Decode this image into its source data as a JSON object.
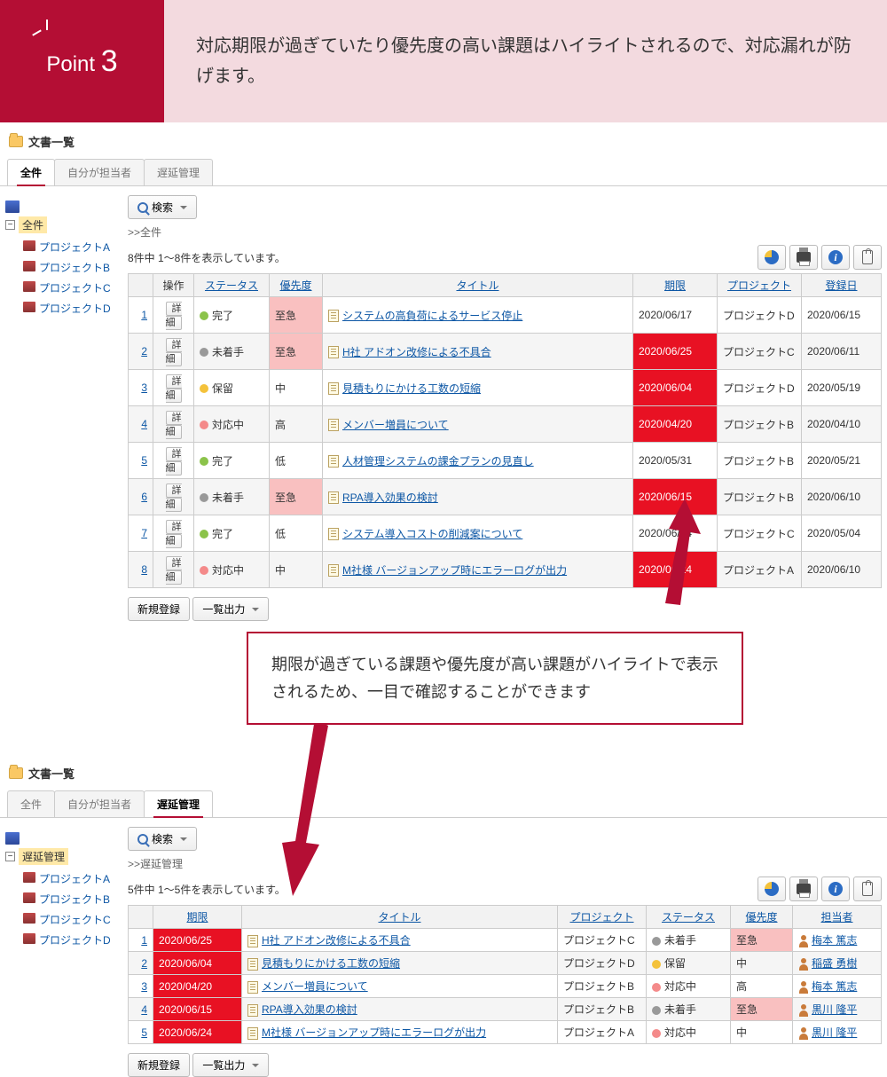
{
  "banner": {
    "point_label": "Point",
    "point_num": "3",
    "text": "対応期限が過ぎていたり優先度の高い課題はハイライトされるので、対応漏れが防げます。"
  },
  "section_title": "文書一覧",
  "tabs": {
    "all": "全件",
    "mine": "自分が担当者",
    "delay": "遅延管理"
  },
  "tree": {
    "toggle": "−",
    "root_all": "全件",
    "root_delay": "遅延管理",
    "items": [
      "プロジェクトA",
      "プロジェクトB",
      "プロジェクトC",
      "プロジェクトD"
    ]
  },
  "toolbar": {
    "search": "検索",
    "new": "新規登録",
    "export": "一覧出力"
  },
  "top": {
    "breadcrumb": ">>全件",
    "count": "8件中 1〜8件を表示しています。",
    "headers": {
      "op": "操作",
      "status": "ステータス",
      "priority": "優先度",
      "title": "タイトル",
      "due": "期限",
      "project": "プロジェクト",
      "reg": "登録日"
    },
    "detail_btn": "詳細",
    "rows": [
      {
        "n": "1",
        "status": "完了",
        "dot": "green",
        "pri": "至急",
        "pri_hl": true,
        "title": "システムの高負荷によるサービス停止",
        "due": "2020/06/17",
        "due_hl": false,
        "proj": "プロジェクトD",
        "reg": "2020/06/15",
        "stripe": false
      },
      {
        "n": "2",
        "status": "未着手",
        "dot": "gray",
        "pri": "至急",
        "pri_hl": true,
        "title": "H社 アドオン改修による不具合",
        "due": "2020/06/25",
        "due_hl": true,
        "proj": "プロジェクトC",
        "reg": "2020/06/11",
        "stripe": true
      },
      {
        "n": "3",
        "status": "保留",
        "dot": "yellow",
        "pri": "中",
        "pri_hl": false,
        "title": "見積もりにかける工数の短縮",
        "due": "2020/06/04",
        "due_hl": true,
        "proj": "プロジェクトD",
        "reg": "2020/05/19",
        "stripe": false
      },
      {
        "n": "4",
        "status": "対応中",
        "dot": "pink",
        "pri": "高",
        "pri_hl": false,
        "title": "メンバー増員について",
        "due": "2020/04/20",
        "due_hl": true,
        "proj": "プロジェクトB",
        "reg": "2020/04/10",
        "stripe": true
      },
      {
        "n": "5",
        "status": "完了",
        "dot": "green",
        "pri": "低",
        "pri_hl": false,
        "title": "人材管理システムの課金プランの見直し",
        "due": "2020/05/31",
        "due_hl": false,
        "proj": "プロジェクトB",
        "reg": "2020/05/21",
        "stripe": false
      },
      {
        "n": "6",
        "status": "未着手",
        "dot": "gray",
        "pri": "至急",
        "pri_hl": true,
        "title": "RPA導入効果の検討",
        "due": "2020/06/15",
        "due_hl": true,
        "proj": "プロジェクトB",
        "reg": "2020/06/10",
        "stripe": true
      },
      {
        "n": "7",
        "status": "完了",
        "dot": "green",
        "pri": "低",
        "pri_hl": false,
        "title": "システム導入コストの削減案について",
        "due": "2020/06/04",
        "due_hl": false,
        "proj": "プロジェクトC",
        "reg": "2020/05/04",
        "stripe": false
      },
      {
        "n": "8",
        "status": "対応中",
        "dot": "pink",
        "pri": "中",
        "pri_hl": false,
        "title": "M社様 バージョンアップ時にエラーログが出力",
        "due": "2020/06/24",
        "due_hl": true,
        "proj": "プロジェクトA",
        "reg": "2020/06/10",
        "stripe": true
      }
    ]
  },
  "callout": {
    "text": "期限が過ぎている課題や優先度が高い課題がハイライトで表示されるため、一目で確認することができます"
  },
  "bottom": {
    "breadcrumb": ">>遅延管理",
    "count": "5件中 1〜5件を表示しています。",
    "headers": {
      "due": "期限",
      "title": "タイトル",
      "project": "プロジェクト",
      "status": "ステータス",
      "priority": "優先度",
      "assignee": "担当者"
    },
    "rows": [
      {
        "n": "1",
        "due": "2020/06/25",
        "title": "H社 アドオン改修による不具合",
        "proj": "プロジェクトC",
        "status": "未着手",
        "dot": "gray",
        "pri": "至急",
        "pri_hl": true,
        "assignee": "梅本 篤志",
        "stripe": false
      },
      {
        "n": "2",
        "due": "2020/06/04",
        "title": "見積もりにかける工数の短縮",
        "proj": "プロジェクトD",
        "status": "保留",
        "dot": "yellow",
        "pri": "中",
        "pri_hl": false,
        "assignee": "稲盛 勇樹",
        "stripe": true
      },
      {
        "n": "3",
        "due": "2020/04/20",
        "title": "メンバー増員について",
        "proj": "プロジェクトB",
        "status": "対応中",
        "dot": "pink",
        "pri": "高",
        "pri_hl": false,
        "assignee": "梅本 篤志",
        "stripe": false
      },
      {
        "n": "4",
        "due": "2020/06/15",
        "title": "RPA導入効果の検討",
        "proj": "プロジェクトB",
        "status": "未着手",
        "dot": "gray",
        "pri": "至急",
        "pri_hl": true,
        "assignee": "黒川 隆平",
        "stripe": true
      },
      {
        "n": "5",
        "due": "2020/06/24",
        "title": "M社様 バージョンアップ時にエラーログが出力",
        "proj": "プロジェクトA",
        "status": "対応中",
        "dot": "pink",
        "pri": "中",
        "pri_hl": false,
        "assignee": "黒川 隆平",
        "stripe": false
      }
    ]
  }
}
